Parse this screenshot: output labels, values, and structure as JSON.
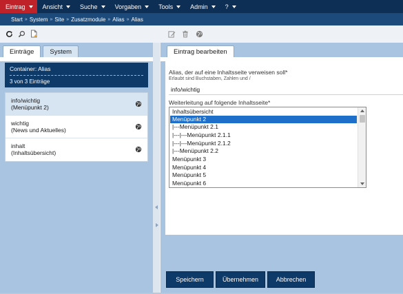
{
  "menu": {
    "items": [
      {
        "label": "Eintrag"
      },
      {
        "label": "Ansicht"
      },
      {
        "label": "Suche"
      },
      {
        "label": "Vorgaben"
      },
      {
        "label": "Tools"
      },
      {
        "label": "Admin"
      },
      {
        "label": "?"
      }
    ]
  },
  "breadcrumb": {
    "items": [
      "Start",
      "System",
      "Site",
      "Zusatzmodule",
      "Alias",
      "Alias"
    ],
    "separator": "»"
  },
  "toolbar_left": {
    "icons": [
      "refresh-icon",
      "search-icon",
      "new-document-icon"
    ]
  },
  "toolbar_right": {
    "icons": [
      "edit-icon",
      "trash-icon",
      "globe-icon"
    ]
  },
  "left_tabs": {
    "entries_label": "Einträge",
    "system_label": "System"
  },
  "container": {
    "title": "Container: Alias",
    "count": "3 von 3 Einträge"
  },
  "entries": [
    {
      "line1": "info/wichtig",
      "line2": "(Menüpunkt 2)"
    },
    {
      "line1": "wichtig",
      "line2": "(News und Aktuelles)"
    },
    {
      "line1": "inhalt",
      "line2": "(Inhaltsübersicht)"
    }
  ],
  "right_tab": {
    "label": "Eintrag bearbeiten"
  },
  "form": {
    "alias_label": "Alias, der auf eine Inhaltsseite verweisen soll*",
    "alias_hint": "Erlaubt sind Buchstaben, Zahlen und /",
    "alias_value": "info/wichtig",
    "redirect_label": "Weiterleitung auf folgende Inhaltsseite*",
    "options": [
      "Inhaltsübersicht",
      "Menüpunkt 2",
      "|---Menüpunkt 2.1",
      "|---|---Menüpunkt 2.1.1",
      "|---|---Menüpunkt 2.1.2",
      "|---Menüpunkt 2.2",
      "Menüpunkt 3",
      "Menüpunkt 4",
      "Menüpunkt 5",
      "Menüpunkt 6"
    ],
    "selected_option": "Menüpunkt 2"
  },
  "buttons": {
    "save": "Speichern",
    "apply": "Übernehmen",
    "cancel": "Abbrechen"
  },
  "colors": {
    "menubar": "#0e2f55",
    "active_menu": "#c0222a",
    "breadcrumb": "#1b4a7b",
    "panel": "#a8c4e0",
    "selected_option": "#1e6fc9",
    "button": "#0e3a6a"
  }
}
